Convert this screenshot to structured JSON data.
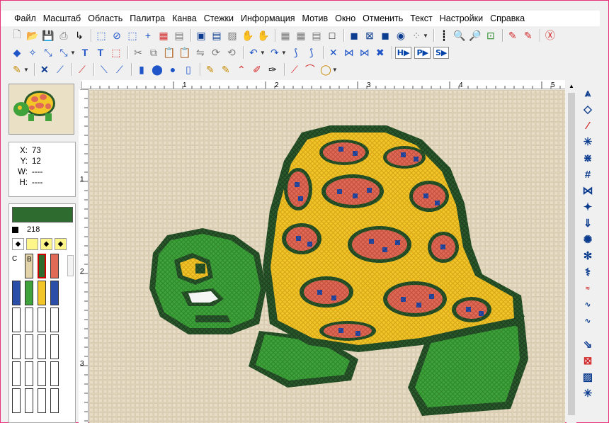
{
  "menu": [
    "Файл",
    "Масштаб",
    "Область",
    "Палитра",
    "Канва",
    "Стежки",
    "Информация",
    "Мотив",
    "Окно",
    "Отменить",
    "Текст",
    "Настройки",
    "Справка"
  ],
  "toolbar_text_buttons": [
    "H",
    "P",
    "S"
  ],
  "coords": {
    "x_label": "X:",
    "x_value": "73",
    "y_label": "Y:",
    "y_value": "12",
    "w_label": "W:",
    "w_value": "----",
    "h_label": "H:",
    "h_value": "----"
  },
  "palette": {
    "current_color": "#2d6b2f",
    "current_number": "218",
    "label_c": "C",
    "label_b": "B"
  },
  "ruler": {
    "top": [
      "1",
      "2",
      "3",
      "4",
      "5"
    ],
    "left": [
      "1",
      "2",
      "3"
    ]
  },
  "colors": {
    "fabric": "#e0d4bc",
    "shell_dark": "#2a5a2c",
    "body": "#3fa23b",
    "yellow": "#f2c529",
    "pink": "#e06a55",
    "blue": "#2b4fa8"
  }
}
